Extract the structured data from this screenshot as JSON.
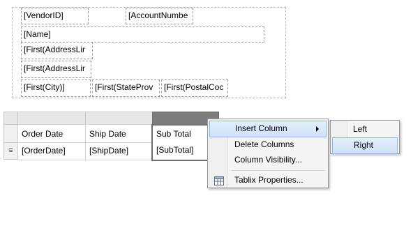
{
  "list": {
    "fields": {
      "vendor_id": "[VendorID]",
      "account_number": "[AccountNumbe",
      "name": "[Name]",
      "address1": "[First(AddressLir",
      "address2": "[First(AddressLir",
      "city": "[First(City)]",
      "state": "[First(StateProv",
      "postal": "[First(PostalCoc"
    }
  },
  "tablix": {
    "row_handle_icon": "≡",
    "headers": [
      "Order Date",
      "Ship Date",
      "Sub Total"
    ],
    "details": [
      "[OrderDate]",
      "[ShipDate]",
      "[SubTotal]"
    ]
  },
  "context_menu": {
    "items": {
      "insert_column": "Insert Column",
      "delete_columns": "Delete Columns",
      "column_visibility": "Column Visibility...",
      "tablix_properties": "Tablix Properties..."
    },
    "icons": {
      "tablix_properties": "tablix-properties-icon"
    }
  },
  "submenu": {
    "items": [
      "Left",
      "Right"
    ],
    "highlighted": "Right"
  },
  "colors": {
    "selected_column_handle": "#7d7d7d",
    "menu_highlight": "#cfe2fa",
    "menu_highlight_border": "#8fb4e2"
  }
}
